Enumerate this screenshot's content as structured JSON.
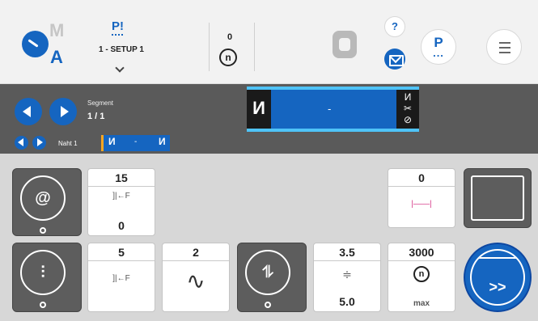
{
  "header": {
    "mode_m": "M",
    "mode_a": "A",
    "program_icon": "P!",
    "program_name": "1 - SETUP 1",
    "count_value": "0",
    "count_symbol": "n",
    "help_label": "?",
    "p_label": "P",
    "p_dots": "...",
    "icons": [
      "mode-icon",
      "q-icon",
      "help-icon",
      "mail-icon",
      "menu-icon",
      "counter-icon"
    ]
  },
  "segment": {
    "label": "Segment",
    "value": "1 / 1",
    "seam_label": "Naht 1",
    "track_center": "-",
    "start_glyph": "И",
    "end_glyph_top": "И",
    "end_glyph_mid": "✂",
    "end_glyph_bot": "⊘",
    "mini_start": "И",
    "mini_mid": "-",
    "mini_end": "И"
  },
  "params": {
    "thread_tension": {
      "top": "15",
      "icon": "]|←F",
      "bottom": "0"
    },
    "foot_pressure": {
      "top": "5",
      "icon": "]|←F",
      "bottom": ""
    },
    "wave": {
      "top": "2",
      "icon": "∿"
    },
    "stitch_length": {
      "top": "3.5",
      "bottom": "5.0"
    },
    "speed": {
      "top": "3000",
      "icon": "n",
      "bottom": "max"
    },
    "distance": {
      "top": "0",
      "icon": "|——|"
    }
  },
  "colors": {
    "accent": "#1565c0",
    "panel_dark": "#5d5d5d",
    "bar_dark": "#5a5a5a",
    "track_highlight": "#4fc3f7",
    "marker_orange": "#f5a623"
  }
}
